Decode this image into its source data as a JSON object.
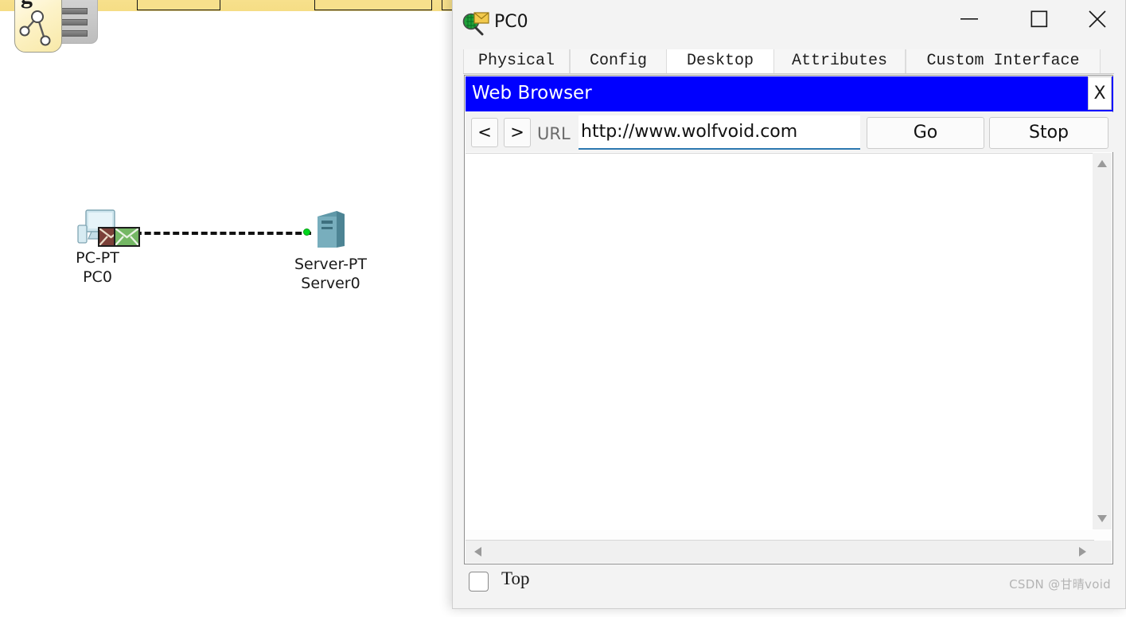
{
  "workspace": {
    "toolbar_letter": "g",
    "topology_icon": "network-topology-icon",
    "rack_icon": "device-rack-icon",
    "devices": [
      {
        "id": "pc0",
        "icon": "pc-desktop-icon",
        "type_label": "PC-PT",
        "name_label": "PC0"
      },
      {
        "id": "server0",
        "icon": "server-tower-icon",
        "type_label": "Server-PT",
        "name_label": "Server0"
      }
    ],
    "link": {
      "name": "copper-straight-through-link",
      "style": "dashed",
      "color": "#111111",
      "endpoint_status_color": "#00d61c"
    },
    "packets": [
      {
        "name": "packet-envelope-brown",
        "color": "#7b4038"
      },
      {
        "name": "packet-envelope-green",
        "color": "#74b764"
      }
    ]
  },
  "window": {
    "title": "PC0",
    "icon": "inspect-device-icon",
    "controls": {
      "minimize": "minimize-icon",
      "maximize": "maximize-icon",
      "close": "close-icon"
    },
    "tabs": [
      {
        "label": "Physical",
        "active": false
      },
      {
        "label": "Config",
        "active": false
      },
      {
        "label": "Desktop",
        "active": true
      },
      {
        "label": "Attributes",
        "active": false
      },
      {
        "label": "Custom Interface",
        "active": false
      }
    ]
  },
  "browser": {
    "title": "Web Browser",
    "title_bg": "#0000ff",
    "close_label": "X",
    "back_label": "<",
    "forward_label": ">",
    "url_label": "URL",
    "url_value": "http://www.wolfvoid.com",
    "url_placeholder": "http://",
    "go_label": "Go",
    "stop_label": "Stop",
    "page_content": ""
  },
  "footer": {
    "top_checkbox_label": "Top",
    "top_checked": false
  },
  "watermark": "CSDN @甘晴void"
}
